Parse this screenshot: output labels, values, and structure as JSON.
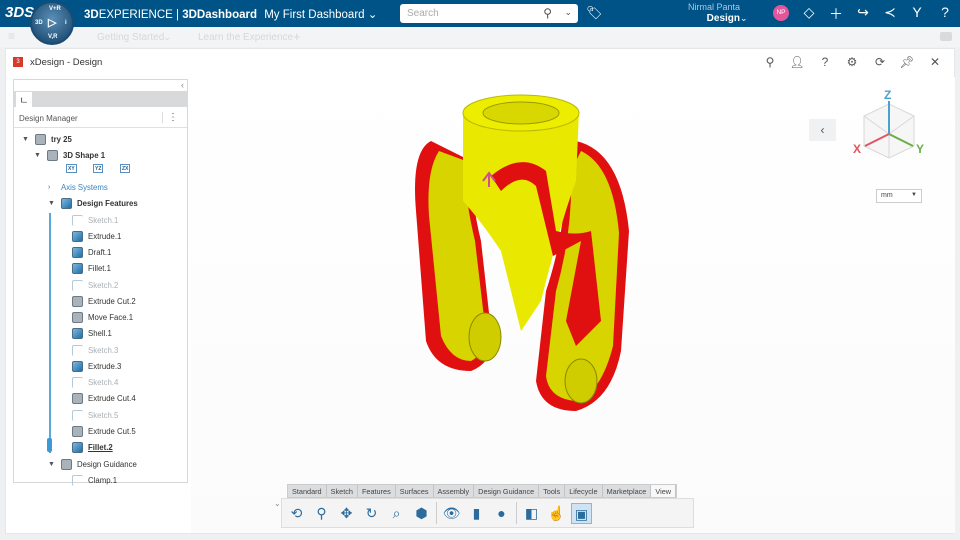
{
  "topbar": {
    "brand_prefix": "3D",
    "brand_experience": "EXPERIENCE",
    "brand_sep": " | ",
    "brand_app": "3DDashboard",
    "dashboard": "My First Dashboard",
    "search_placeholder": "Search",
    "user_name": "Nirmal Panta",
    "user_role": "Design",
    "avatar_initials": "NP",
    "compass": {
      "top": "V+R",
      "left": "3D",
      "right": "i",
      "bottom": "V,R"
    }
  },
  "tabs": {
    "items": [
      "Getting Started",
      "Learn the Experience"
    ]
  },
  "widget": {
    "title": "xDesign - Design"
  },
  "panel": {
    "header": "Design Manager",
    "tree": [
      {
        "label": "try 25",
        "level": 0,
        "icon": "part",
        "style": "bold"
      },
      {
        "label": "3D Shape 1",
        "level": 1,
        "icon": "shape",
        "style": "bold"
      },
      {
        "label": "Axis Systems",
        "level": 2,
        "icon": "chevron",
        "style": "link"
      },
      {
        "label": "Design Features",
        "level": 2,
        "icon": "features",
        "style": "bold"
      },
      {
        "label": "Sketch.1",
        "style": "faded",
        "icon": "sketch"
      },
      {
        "label": "Extrude.1",
        "icon": "cube"
      },
      {
        "label": "Draft.1",
        "icon": "cube"
      },
      {
        "label": "Fillet.1",
        "icon": "cube"
      },
      {
        "label": "Sketch.2",
        "style": "faded",
        "icon": "sketch"
      },
      {
        "label": "Extrude Cut.2",
        "icon": "cut"
      },
      {
        "label": "Move Face.1",
        "icon": "cut"
      },
      {
        "label": "Shell.1",
        "icon": "cube"
      },
      {
        "label": "Sketch.3",
        "style": "faded",
        "icon": "sketch"
      },
      {
        "label": "Extrude.3",
        "icon": "cube"
      },
      {
        "label": "Sketch.4",
        "style": "faded",
        "icon": "sketch"
      },
      {
        "label": "Extrude Cut.4",
        "icon": "cut"
      },
      {
        "label": "Sketch.5",
        "style": "faded",
        "icon": "sketch"
      },
      {
        "label": "Extrude Cut.5",
        "icon": "cut"
      },
      {
        "label": "Fillet.2",
        "icon": "cube",
        "style": "bold-underline"
      },
      {
        "label": "Design Guidance",
        "icon": "guidance"
      },
      {
        "label": "Clamp.1",
        "icon": "clamp"
      }
    ],
    "planes": [
      "XY",
      "YZ",
      "ZX"
    ]
  },
  "toolbar": {
    "tabs": [
      "Standard",
      "Sketch",
      "Features",
      "Surfaces",
      "Assembly",
      "Design Guidance",
      "Tools",
      "Lifecycle",
      "Marketplace",
      "View"
    ],
    "active": "View"
  },
  "viewcube": {
    "x": "X",
    "y": "Y",
    "z": "Z",
    "unit": "mm"
  },
  "colors": {
    "topbar": "#005386",
    "model_yellow": "#e6e600",
    "model_red": "#e01010"
  }
}
